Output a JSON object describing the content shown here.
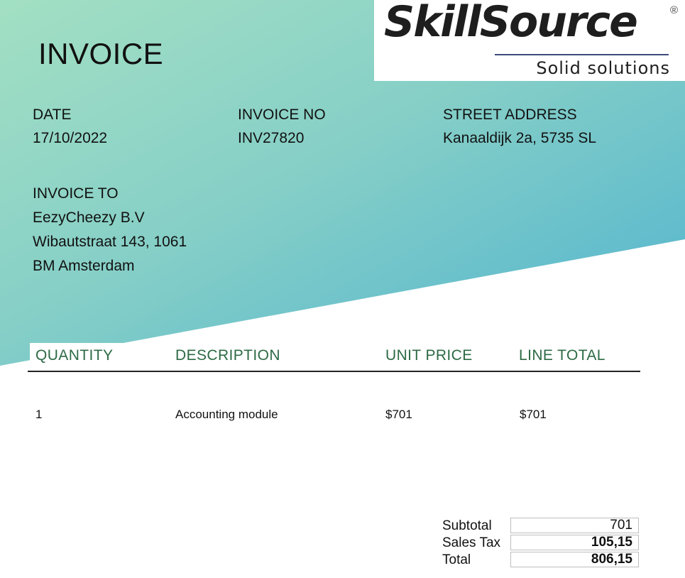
{
  "invoice_title": "INVOICE",
  "logo": {
    "brand": "SkillSource",
    "registered_mark": "®",
    "tagline": "Solid solutions"
  },
  "meta": {
    "date_label": "DATE",
    "date_value": "17/10/2022",
    "invoice_no_label": "INVOICE NO",
    "invoice_no_value": "INV27820",
    "street_address_label": "STREET ADDRESS",
    "street_address_value": "Kanaaldijk 2a, 5735 SL"
  },
  "invoice_to": {
    "label": "INVOICE TO",
    "lines": [
      "EezyCheezy B.V",
      "Wibautstraat 143, 1061",
      "BM Amsterdam"
    ]
  },
  "table": {
    "headers": [
      "QUANTITY",
      "DESCRIPTION",
      "UNIT PRICE",
      "LINE TOTAL"
    ],
    "rows": [
      {
        "quantity": "1",
        "description": "Accounting module",
        "unit_price": "$701",
        "line_total": "$701"
      }
    ]
  },
  "totals": [
    {
      "label": "Subtotal",
      "value": "701"
    },
    {
      "label": "Sales Tax",
      "value": "105,15"
    },
    {
      "label": "Total",
      "value": "806,15"
    }
  ],
  "colors": {
    "gradient_start": "#a3e0c3",
    "gradient_end": "#4fb3cf",
    "header_text": "#2c6a44",
    "logo_rule": "#3d4a7a"
  }
}
